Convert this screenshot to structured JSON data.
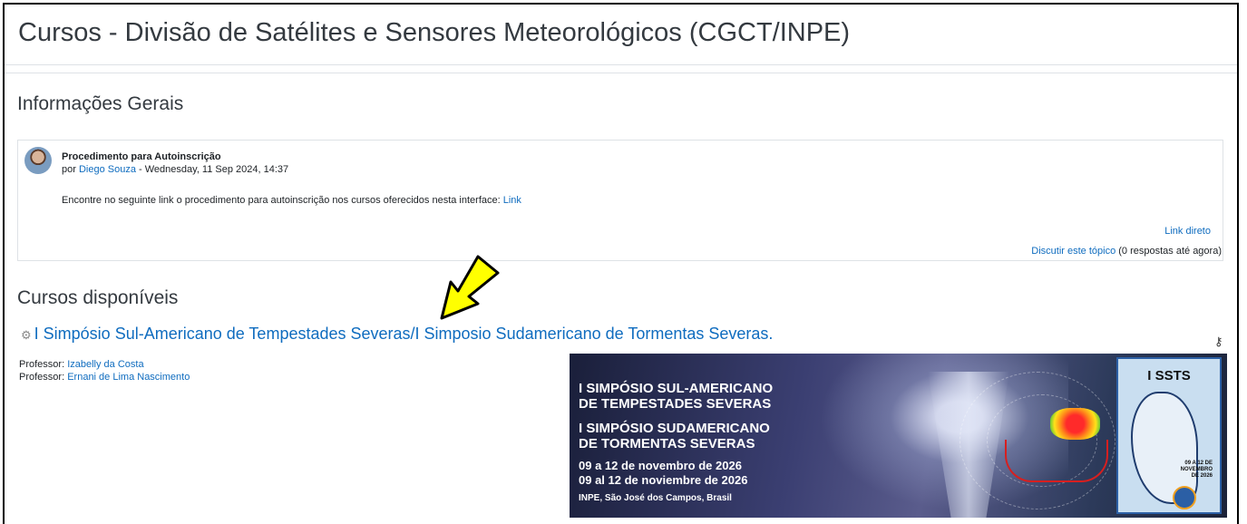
{
  "page": {
    "title": "Cursos - Divisão de Satélites e Sensores Meteorológicos (CGCT/INPE)"
  },
  "info": {
    "heading": "Informações Gerais",
    "post": {
      "subject": "Procedimento para Autoinscrição",
      "by_prefix": "por",
      "author": "Diego Souza",
      "date": " - Wednesday, 11 Sep 2024, 14:37",
      "body_text": "Encontre no seguinte link o procedimento para autoinscrição nos cursos oferecidos nesta interface: ",
      "body_link": "Link",
      "permalink": "Link direto",
      "discuss_link": "Discutir este tópico",
      "replies": " (0 respostas até agora)"
    }
  },
  "courses": {
    "heading": "Cursos disponíveis",
    "items": [
      {
        "name": "I Simpósio Sul-Americano de Tempestades Severas/I Simposio Sudamericano de Tormentas Severas.",
        "contacts": [
          {
            "role": "Professor:",
            "name": "Izabelly da Costa"
          },
          {
            "role": "Professor:",
            "name": "Ernani de Lima Nascimento"
          }
        ],
        "banner": {
          "line1": "I SIMPÓSIO SUL-AMERICANO",
          "line2": "DE TEMPESTADES SEVERAS",
          "line3": "I SIMPÓSIO SUDAMERICANO",
          "line4": "DE TORMENTAS SEVERAS",
          "line5": "09 a 12 de novembro de 2026",
          "line6": "09 al 12 de noviembre de 2026",
          "line7": "INPE, São José dos Campos, Brasil",
          "side_title": "I SSTS",
          "side_date1": "09 A 12 DE",
          "side_date2": "NOVEMBRO",
          "side_date3": "DE 2026"
        }
      }
    ]
  },
  "icons": {
    "course_icon": "course-icon",
    "key_icon": "key-icon",
    "arrow": "yellow-arrow-annotation"
  },
  "colors": {
    "link": "#0f6cbf",
    "arrow": "#ffff00"
  }
}
